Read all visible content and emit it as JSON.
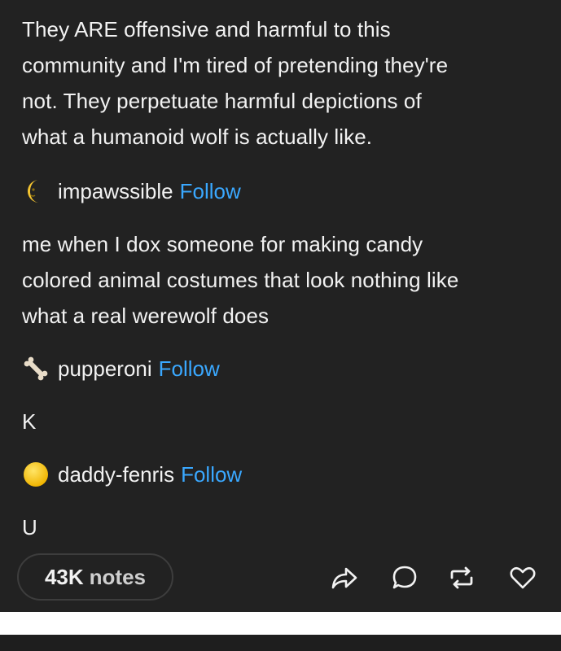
{
  "post": {
    "op_text": [
      "They ARE offensive and harmful to this",
      "community and I'm tired of pretending they're",
      "not. They perpetuate harmful depictions of",
      "what a humanoid wolf is actually like."
    ],
    "reblogs": [
      {
        "username": "impawssible",
        "follow_label": "Follow",
        "avatar_icon": "crescent-moon-icon",
        "text": [
          "me when I dox someone for making candy",
          "colored animal costumes that look nothing like",
          "what a real werewolf does"
        ]
      },
      {
        "username": "pupperoni",
        "follow_label": "Follow",
        "avatar_icon": "bone-icon",
        "text": [
          "K"
        ]
      },
      {
        "username": "daddy-fenris",
        "follow_label": "Follow",
        "avatar_icon": "yellow-circle-icon",
        "text": [
          "U"
        ]
      }
    ]
  },
  "footer": {
    "notes_count": "43K",
    "notes_label": "notes",
    "actions": [
      "share-icon",
      "reply-icon",
      "reblog-icon",
      "like-icon"
    ]
  },
  "colors": {
    "background": "#222222",
    "text": "#f2f2f2",
    "follow": "#3aa8ff",
    "pill_border": "#3d3d3d"
  }
}
